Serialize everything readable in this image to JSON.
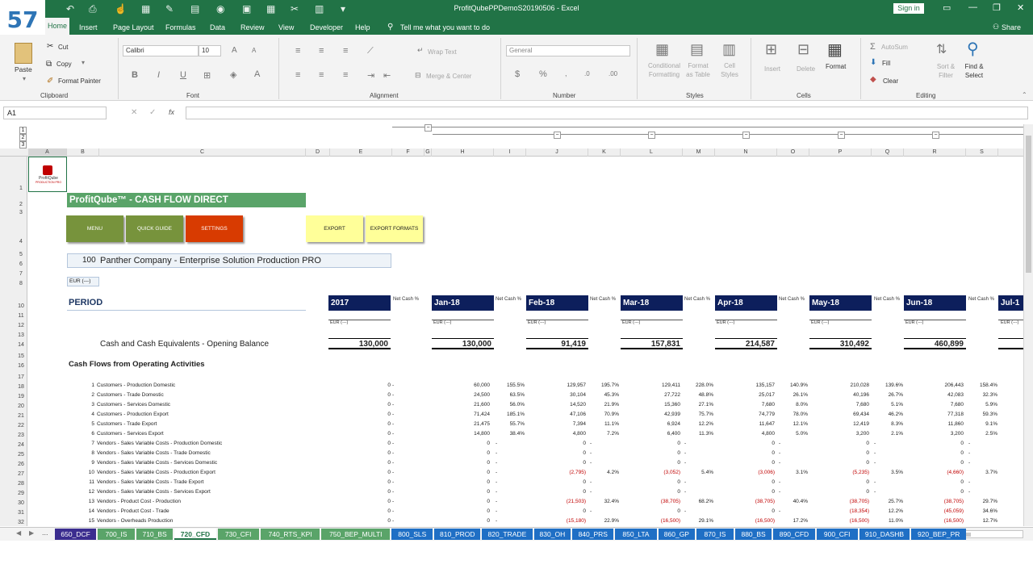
{
  "app": {
    "title": "ProfitQubePPDemoS20190506 - Excel",
    "signin": "Sign in",
    "share": "Share",
    "tell_me": "Tell me what you want to do",
    "badge": "57"
  },
  "ribbon_tabs": [
    "Home",
    "Insert",
    "Page Layout",
    "Formulas",
    "Data",
    "Review",
    "View",
    "Developer",
    "Help"
  ],
  "clipboard": {
    "paste": "Paste",
    "cut": "Cut",
    "copy": "Copy",
    "format_painter": "Format Painter",
    "label": "Clipboard"
  },
  "font": {
    "name": "Calibri",
    "size": "10",
    "label": "Font"
  },
  "alignment": {
    "wrap": "Wrap Text",
    "merge": "Merge & Center",
    "label": "Alignment"
  },
  "number": {
    "format": "General",
    "label": "Number"
  },
  "styles": {
    "cond": "Conditional Formatting",
    "table": "Format as Table",
    "cell": "Cell Styles",
    "label": "Styles"
  },
  "cells": {
    "insert": "Insert",
    "delete": "Delete",
    "format": "Format",
    "label": "Cells"
  },
  "editing": {
    "autosum": "AutoSum",
    "fill": "Fill",
    "clear": "Clear",
    "sort": "Sort & Filter",
    "find": "Find & Select",
    "label": "Editing"
  },
  "namebox": "A1",
  "columns": [
    "A",
    "B",
    "C",
    "D",
    "E",
    "F",
    "G",
    "H",
    "I",
    "J",
    "K",
    "L",
    "M",
    "N",
    "O",
    "P",
    "Q",
    "R",
    "S"
  ],
  "rows": [
    "1",
    "2",
    "3",
    "4",
    "5",
    "6",
    "7",
    "8",
    "10",
    "11",
    "12",
    "13",
    "14",
    "15",
    "16",
    "17",
    "18",
    "19",
    "20",
    "21",
    "22",
    "23",
    "24",
    "25",
    "26",
    "27",
    "28",
    "29",
    "30",
    "31",
    "32"
  ],
  "outline_levels": [
    "1",
    "2",
    "3"
  ],
  "sheet": {
    "logo_name": "ProfitQube",
    "logo_sub": "PRODUCTION PRO",
    "header": "ProfitQube™ - CASH FLOW DIRECT",
    "buttons": {
      "menu": "MENU",
      "quick": "QUICK GUIDE",
      "settings": "SETTINGS",
      "export": "EXPORT",
      "export_formats": "EXPORT FORMATS"
    },
    "company_num": "100",
    "company": "Panther Company - Enterprise Solution Production PRO",
    "currency": "EUR (---)",
    "period": "PERIOD",
    "periods": [
      "2017",
      "Jan-18",
      "Feb-18",
      "Mar-18",
      "Apr-18",
      "May-18",
      "Jun-18",
      "Jul-1"
    ],
    "net_cash": "Net Cash %",
    "eur_small": "EUR (---)",
    "opening_label": "Cash and Cash Equivalents - Opening Balance",
    "opening": [
      "130,000",
      "130,000",
      "91,419",
      "157,831",
      "214,587",
      "310,492",
      "460,899"
    ],
    "section": "Cash Flows from Operating Activities",
    "lines": [
      {
        "n": "1",
        "t": "Customers - Production Domestic",
        "v": [
          "0",
          "60,000",
          "129,957",
          "129,411",
          "135,157",
          "210,028",
          "206,443"
        ],
        "p": [
          "-",
          "155.5%",
          "195.7%",
          "228.0%",
          "140.9%",
          "139.6%",
          "158.4%"
        ]
      },
      {
        "n": "2",
        "t": "Customers - Trade Domestic",
        "v": [
          "0",
          "24,500",
          "30,104",
          "27,722",
          "25,017",
          "40,196",
          "42,083"
        ],
        "p": [
          "-",
          "63.5%",
          "45.3%",
          "48.8%",
          "26.1%",
          "26.7%",
          "32.3%"
        ]
      },
      {
        "n": "3",
        "t": "Customers - Services Domestic",
        "v": [
          "0",
          "21,600",
          "14,520",
          "15,360",
          "7,680",
          "7,680",
          "7,680"
        ],
        "p": [
          "-",
          "56.0%",
          "21.9%",
          "27.1%",
          "8.0%",
          "5.1%",
          "5.9%"
        ]
      },
      {
        "n": "4",
        "t": "Customers - Production Export",
        "v": [
          "0",
          "71,424",
          "47,106",
          "42,939",
          "74,779",
          "69,434",
          "77,318"
        ],
        "p": [
          "-",
          "185.1%",
          "70.9%",
          "75.7%",
          "78.0%",
          "46.2%",
          "59.3%"
        ]
      },
      {
        "n": "5",
        "t": "Customers - Trade Export",
        "v": [
          "0",
          "21,475",
          "7,394",
          "6,924",
          "11,647",
          "12,419",
          "11,860"
        ],
        "p": [
          "-",
          "55.7%",
          "11.1%",
          "12.2%",
          "12.1%",
          "8.3%",
          "9.1%"
        ]
      },
      {
        "n": "6",
        "t": "Customers - Services Export",
        "v": [
          "0",
          "14,800",
          "4,800",
          "6,400",
          "4,800",
          "3,200",
          "3,200"
        ],
        "p": [
          "-",
          "38.4%",
          "7.2%",
          "11.3%",
          "5.0%",
          "2.1%",
          "2.5%"
        ]
      },
      {
        "n": "7",
        "t": "Vendors - Sales Variable Costs - Production Domestic",
        "v": [
          "0",
          "0",
          "0",
          "0",
          "0",
          "0",
          "0"
        ],
        "p": [
          "-",
          "-",
          "-",
          "-",
          "-",
          "-",
          "-"
        ]
      },
      {
        "n": "8",
        "t": "Vendors - Sales Variable Costs - Trade Domestic",
        "v": [
          "0",
          "0",
          "0",
          "0",
          "0",
          "0",
          "0"
        ],
        "p": [
          "-",
          "-",
          "-",
          "-",
          "-",
          "-",
          "-"
        ]
      },
      {
        "n": "9",
        "t": "Vendors - Sales Variable Costs - Services Domestic",
        "v": [
          "0",
          "0",
          "0",
          "0",
          "0",
          "0",
          "0"
        ],
        "p": [
          "-",
          "-",
          "-",
          "-",
          "-",
          "-",
          "-"
        ]
      },
      {
        "n": "10",
        "t": "Vendors - Sales Variable Costs - Production Export",
        "v": [
          "0",
          "0",
          "(2,795)",
          "(3,052)",
          "(3,006)",
          "(5,235)",
          "(4,660)"
        ],
        "p": [
          "-",
          "-",
          "4.2%",
          "5.4%",
          "3.1%",
          "3.5%",
          "3.7%"
        ]
      },
      {
        "n": "11",
        "t": "Vendors - Sales Variable Costs - Trade Export",
        "v": [
          "0",
          "0",
          "0",
          "0",
          "0",
          "0",
          "0"
        ],
        "p": [
          "-",
          "-",
          "-",
          "-",
          "-",
          "-",
          "-"
        ]
      },
      {
        "n": "12",
        "t": "Vendors - Sales Variable Costs - Services Export",
        "v": [
          "0",
          "0",
          "0",
          "0",
          "0",
          "0",
          "0"
        ],
        "p": [
          "-",
          "-",
          "-",
          "-",
          "-",
          "-",
          "-"
        ]
      },
      {
        "n": "13",
        "t": "Vendors - Product Cost - Production",
        "v": [
          "0",
          "0",
          "(21,503)",
          "(38,705)",
          "(38,705)",
          "(38,705)",
          "(38,705)"
        ],
        "p": [
          "-",
          "-",
          "32.4%",
          "68.2%",
          "40.4%",
          "25.7%",
          "29.7%"
        ]
      },
      {
        "n": "14",
        "t": "Vendors - Product Cost - Trade",
        "v": [
          "0",
          "0",
          "0",
          "0",
          "0",
          "(18,354)",
          "(45,059)"
        ],
        "p": [
          "-",
          "-",
          "-",
          "-",
          "-",
          "12.2%",
          "34.6%"
        ]
      },
      {
        "n": "15",
        "t": "Vendors - Overheads Production",
        "v": [
          "0",
          "0",
          "(15,180)",
          "(16,500)",
          "(16,500)",
          "(16,500)",
          "(16,500)"
        ],
        "p": [
          "-",
          "-",
          "22.9%",
          "29.1%",
          "17.2%",
          "11.0%",
          "12.7%"
        ]
      }
    ]
  },
  "sheet_tabs": [
    {
      "l": "650_DCF",
      "c": "#3b2d8f"
    },
    {
      "l": "700_IS",
      "c": "#5aa469"
    },
    {
      "l": "710_BS",
      "c": "#5aa469"
    },
    {
      "l": "720_CFD",
      "c": "#ffffff"
    },
    {
      "l": "730_CFI",
      "c": "#5aa469"
    },
    {
      "l": "740_RTS_KPI",
      "c": "#5aa469"
    },
    {
      "l": "750_BEP_MULTI",
      "c": "#5aa469"
    },
    {
      "l": "800_SLS",
      "c": "#1f6fc5"
    },
    {
      "l": "810_PROD",
      "c": "#1f6fc5"
    },
    {
      "l": "820_TRADE",
      "c": "#1f6fc5"
    },
    {
      "l": "830_OH",
      "c": "#1f6fc5"
    },
    {
      "l": "840_PRS",
      "c": "#1f6fc5"
    },
    {
      "l": "850_LTA",
      "c": "#1f6fc5"
    },
    {
      "l": "860_GP",
      "c": "#1f6fc5"
    },
    {
      "l": "870_IS",
      "c": "#1f6fc5"
    },
    {
      "l": "880_BS",
      "c": "#1f6fc5"
    },
    {
      "l": "890_CFD",
      "c": "#1f6fc5"
    },
    {
      "l": "900_CFI",
      "c": "#1f6fc5"
    },
    {
      "l": "910_DASHB",
      "c": "#1f6fc5"
    },
    {
      "l": "920_BEP_PR",
      "c": "#1f6fc5"
    }
  ],
  "ellipsis": "..."
}
